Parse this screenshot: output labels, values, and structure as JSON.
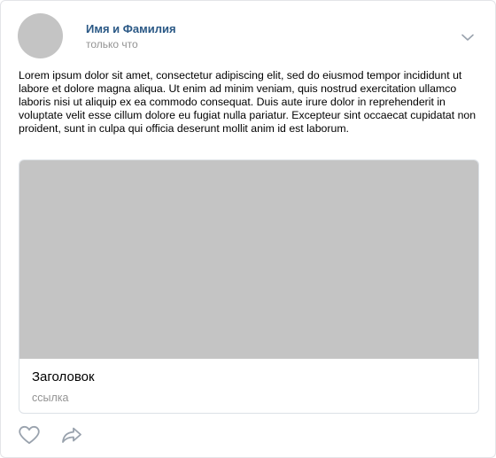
{
  "post": {
    "author_name": "Имя и Фамилия",
    "time": "только что",
    "text": "Lorem ipsum dolor sit amet, consectetur adipiscing elit, sed do eiusmod tempor incididunt ut labore et dolore magna aliqua. Ut enim ad minim veniam, quis nostrud exercitation ullamco laboris nisi ut aliquip ex ea commodo consequat. Duis aute irure dolor in reprehenderit in voluptate velit esse cillum dolore eu fugiat nulla pariatur. Excepteur sint occaecat cupidatat non proident, sunt in culpa qui officia deserunt mollit anim id est laborum."
  },
  "link_card": {
    "title": "Заголовок",
    "link": "ссылка"
  },
  "icons": {
    "menu": "chevron-down-icon",
    "like": "heart-icon",
    "share": "share-icon"
  },
  "colors": {
    "author_name": "#2a5885",
    "secondary_text": "#939393",
    "placeholder": "#c4c4c4",
    "icon": "#99a2ad",
    "border": "#e3e4e8"
  }
}
